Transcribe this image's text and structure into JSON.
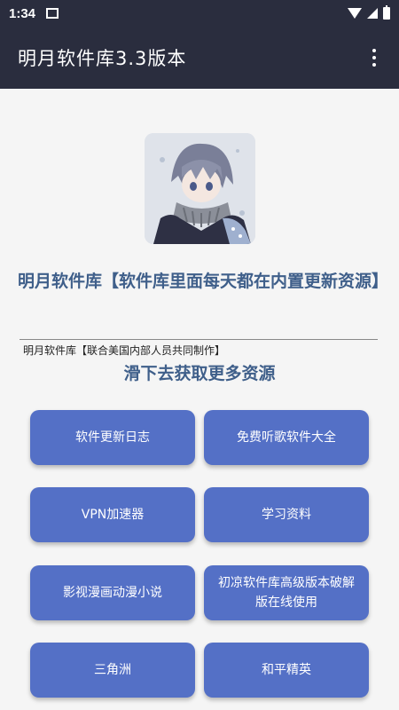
{
  "status": {
    "time": "1:34"
  },
  "app": {
    "title": "明月软件库3.3版本"
  },
  "main": {
    "headline": "明月软件库【软件库里面每天都在内置更新资源】",
    "caption": "明月软件库【联合美国内部人员共同制作】",
    "slide_hint": "滑下去获取更多资源"
  },
  "buttons": [
    {
      "label": "软件更新日志"
    },
    {
      "label": "免费听歌软件大全"
    },
    {
      "label": "VPN加速器"
    },
    {
      "label": "学习资料"
    },
    {
      "label": "影视漫画动漫小说"
    },
    {
      "label": "初凉软件库高级版本破解版在线使用"
    },
    {
      "label": "三角洲"
    },
    {
      "label": "和平精英"
    }
  ],
  "colors": {
    "bar": "#2a2d3e",
    "accent_text": "#3f5f8a",
    "button": "#5470c6"
  }
}
